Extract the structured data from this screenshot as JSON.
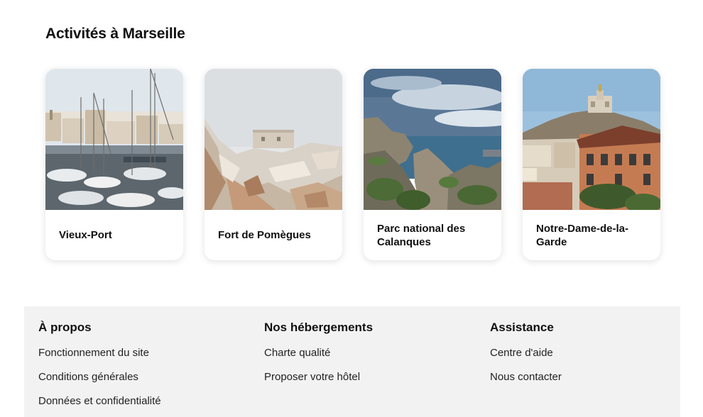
{
  "section": {
    "title": "Activités à Marseille"
  },
  "cards": [
    {
      "title": "Vieux-Port",
      "image": "marina-photo"
    },
    {
      "title": "Fort de Pomègues",
      "image": "rocky-fort-photo"
    },
    {
      "title": "Parc national des Calanques",
      "image": "calanques-cliffs-photo"
    },
    {
      "title": "Notre-Dame-de-la-Garde",
      "image": "basilica-city-photo"
    }
  ],
  "footer": {
    "about": {
      "heading": "À propos",
      "links": [
        "Fonctionnement du site",
        "Conditions générales",
        "Données et confidentialité"
      ]
    },
    "accommodations": {
      "heading": "Nos hébergements",
      "links": [
        "Charte qualité",
        "Proposer votre hôtel"
      ]
    },
    "support": {
      "heading": "Assistance",
      "links": [
        "Centre d'aide",
        "Nous contacter"
      ]
    }
  }
}
